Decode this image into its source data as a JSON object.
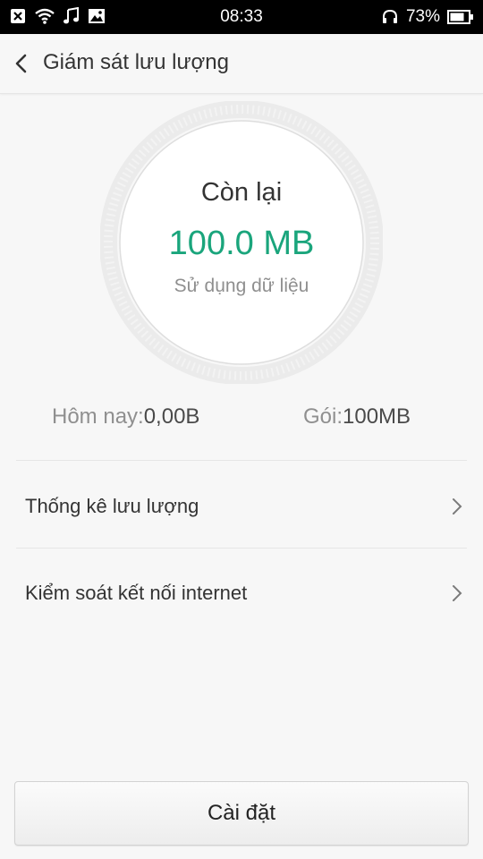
{
  "status_bar": {
    "time": "08:33",
    "battery_percent": "73%",
    "icons_left": [
      "close-notification-icon",
      "wifi-icon",
      "music-note-icon",
      "image-icon"
    ],
    "icons_right": [
      "headphones-icon",
      "battery-icon"
    ]
  },
  "header": {
    "back_icon": "chevron-left-icon",
    "title": "Giám sát lưu lượng"
  },
  "usage_ring": {
    "remaining_label": "Còn lại",
    "remaining_value": "100.0 MB",
    "usage_label": "Sử dụng dữ liệu",
    "remaining_fraction": 1.0
  },
  "stats": {
    "today_label": "Hôm nay:",
    "today_value": "0,00B",
    "plan_label": "Gói:",
    "plan_value": "100MB"
  },
  "menu": {
    "items": [
      {
        "label": "Thống kê lưu lượng",
        "icon": "chevron-right-icon"
      },
      {
        "label": "Kiểm soát kết nối internet",
        "icon": "chevron-right-icon"
      }
    ]
  },
  "footer": {
    "settings_label": "Cài đặt"
  },
  "colors": {
    "accent": "#1aa57c",
    "secondary_text": "#8f8f8f",
    "background": "#f7f7f7"
  }
}
